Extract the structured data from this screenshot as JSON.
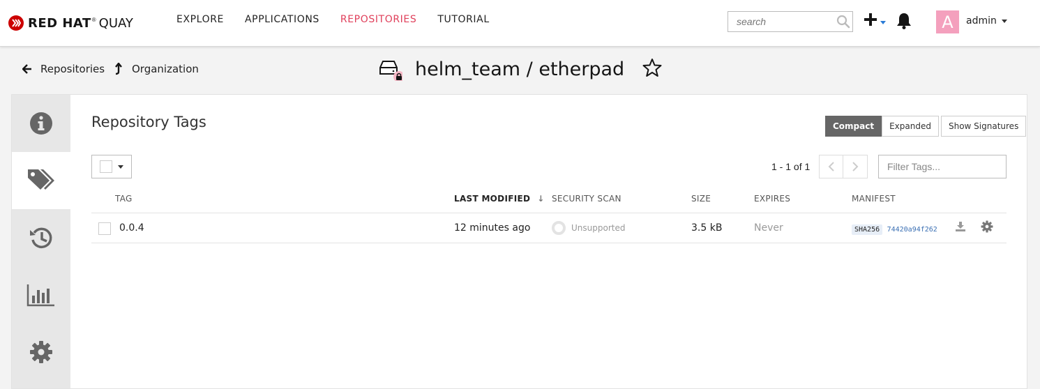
{
  "brand": {
    "bold": "RED HAT",
    "registered": "®",
    "light": "QUAY"
  },
  "nav": {
    "items": [
      {
        "label": "EXPLORE",
        "active": false
      },
      {
        "label": "APPLICATIONS",
        "active": false
      },
      {
        "label": "REPOSITORIES",
        "active": true
      },
      {
        "label": "TUTORIAL",
        "active": false
      }
    ],
    "active_color": "#e0405b"
  },
  "search": {
    "placeholder": "search"
  },
  "user": {
    "avatar_letter": "A",
    "avatar_color": "#f4a0bd",
    "name": "admin"
  },
  "breadcrumbs": [
    {
      "label": "Repositories",
      "icon": "arrow-left-icon"
    },
    {
      "label": "Organization",
      "icon": "arrow-up-icon"
    }
  ],
  "repo": {
    "title": "helm_team / etherpad",
    "private": true
  },
  "side_tabs": [
    {
      "name": "info-icon",
      "active": false
    },
    {
      "name": "tags-icon",
      "active": true
    },
    {
      "name": "history-icon",
      "active": false
    },
    {
      "name": "usage-logs-icon",
      "active": false
    },
    {
      "name": "settings-icon",
      "active": false
    }
  ],
  "tags_section": {
    "title": "Repository Tags",
    "view_buttons": {
      "compact": "Compact",
      "expanded": "Expanded",
      "signatures": "Show Signatures",
      "active": "compact"
    },
    "pagination": "1 - 1 of 1",
    "filter_placeholder": "Filter Tags...",
    "columns": {
      "tag": "TAG",
      "last_modified": "LAST MODIFIED",
      "security_scan": "SECURITY SCAN",
      "size": "SIZE",
      "expires": "EXPIRES",
      "manifest": "MANIFEST"
    },
    "rows": [
      {
        "tag": "0.0.4",
        "last_modified": "12 minutes ago",
        "security_scan": "Unsupported",
        "size": "3.5 kB",
        "expires": "Never",
        "manifest_algo": "SHA256",
        "manifest_hash": "74420a94f262"
      }
    ]
  }
}
